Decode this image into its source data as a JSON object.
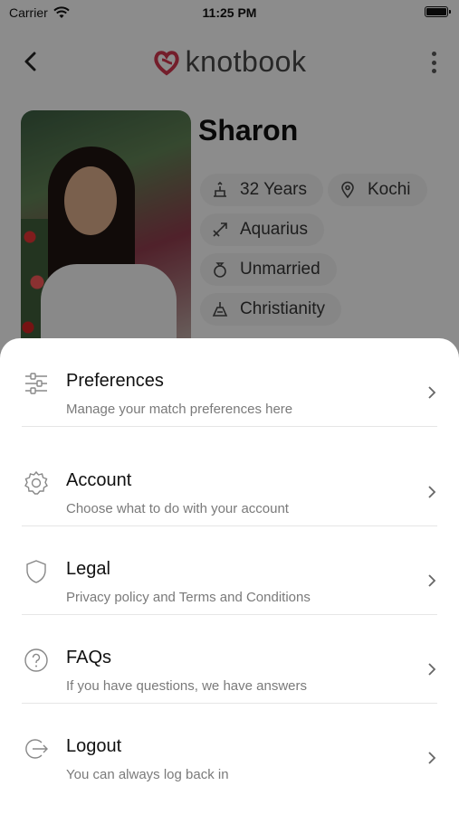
{
  "status_bar": {
    "carrier": "Carrier",
    "time": "11:25 PM"
  },
  "header": {
    "logo_text": "knotbook",
    "brand_color": "#c8344a"
  },
  "profile": {
    "name": "Sharon",
    "chips": [
      {
        "icon": "cake-icon",
        "text": "32 Years"
      },
      {
        "icon": "location-pin-icon",
        "text": "Kochi"
      },
      {
        "icon": "zodiac-arrow-icon",
        "text": "Aquarius"
      },
      {
        "icon": "ring-icon",
        "text": "Unmarried"
      },
      {
        "icon": "religion-icon",
        "text": "Christianity"
      }
    ]
  },
  "menu": {
    "items": [
      {
        "title": "Preferences",
        "subtitle": "Manage your match preferences here",
        "icon": "sliders-icon"
      },
      {
        "title": "Account",
        "subtitle": "Choose what to do with your account",
        "icon": "gear-icon"
      },
      {
        "title": "Legal",
        "subtitle": "Privacy policy and Terms and Conditions",
        "icon": "shield-icon"
      },
      {
        "title": "FAQs",
        "subtitle": "If you have questions, we have answers",
        "icon": "question-circle-icon"
      },
      {
        "title": "Logout",
        "subtitle": "You can always log back in",
        "icon": "logout-icon"
      }
    ]
  }
}
